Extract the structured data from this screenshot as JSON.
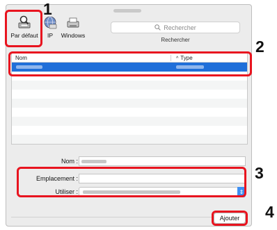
{
  "toolbar": {
    "default_label": "Par défaut",
    "ip_label": "IP",
    "windows_label": "Windows",
    "search_placeholder": "Rechercher",
    "search_caption": "Rechercher"
  },
  "list": {
    "col_name": "Nom",
    "col_type": "Type",
    "sort_arrow": "^"
  },
  "form": {
    "name_label": "Nom :",
    "location_label": "Emplacement :",
    "use_label": "Utiliser :"
  },
  "buttons": {
    "add_label": "Ajouter"
  },
  "callouts": [
    "1",
    "2",
    "3",
    "4"
  ],
  "colors": {
    "highlight": "#e8141f",
    "selection": "#1f6fd9",
    "select_arrow": "#3d8ff2"
  }
}
